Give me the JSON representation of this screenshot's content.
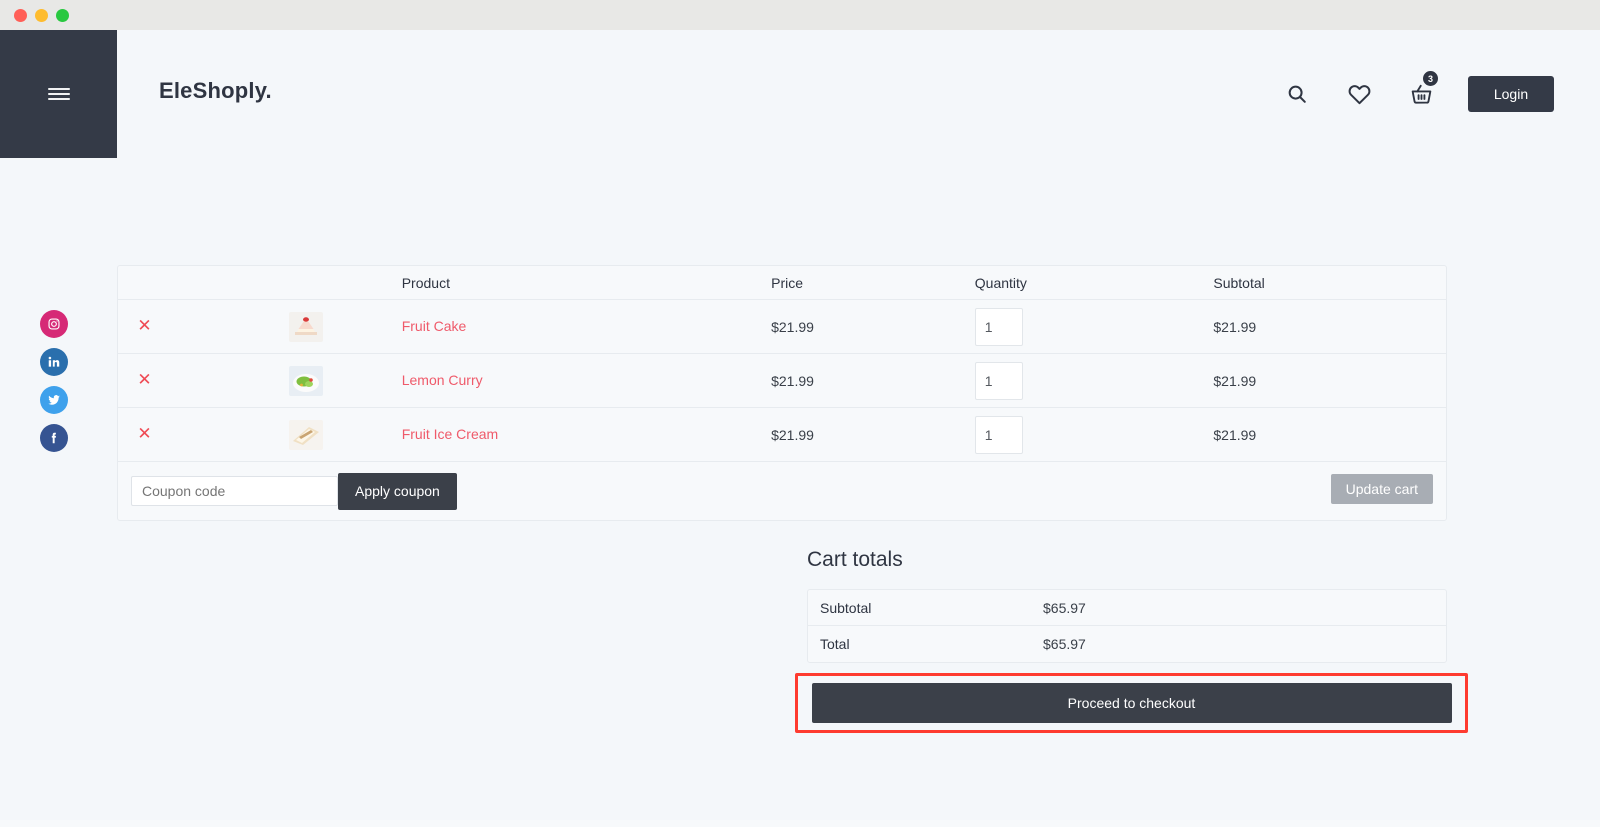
{
  "window": {
    "traffic_lights": [
      {
        "name": "close",
        "color": "#FF5F57"
      },
      {
        "name": "minimize",
        "color": "#FEBC2E"
      },
      {
        "name": "maximize",
        "color": "#28C840"
      }
    ]
  },
  "header": {
    "brand": "EleShoply.",
    "search_icon": "search-icon",
    "wishlist_icon": "heart-icon",
    "cart_icon": "shopping-basket-icon",
    "cart_count": "3",
    "login_label": "Login",
    "menu_icon": "hamburger-menu-icon"
  },
  "social": [
    {
      "name": "instagram",
      "glyph": "◎",
      "color": "#d62976"
    },
    {
      "name": "linkedin",
      "glyph": "in",
      "color": "#2a6fad"
    },
    {
      "name": "twitter",
      "glyph": "✉",
      "color": "#3ea1ec"
    },
    {
      "name": "facebook",
      "glyph": "f",
      "color": "#365492"
    }
  ],
  "cart": {
    "columns": [
      "",
      "",
      "Product",
      "Price",
      "Quantity",
      "Subtotal"
    ],
    "header": {
      "product": "Product",
      "price": "Price",
      "quantity": "Quantity",
      "subtotal": "Subtotal"
    },
    "remove_glyph": "✕",
    "items": [
      {
        "name": "Fruit Cake",
        "price": "$21.99",
        "quantity": "1",
        "subtotal": "$21.99",
        "thumb": "cake-slice-thumbnail"
      },
      {
        "name": "Lemon Curry",
        "price": "$21.99",
        "quantity": "1",
        "subtotal": "$21.99",
        "thumb": "salad-plate-thumbnail"
      },
      {
        "name": "Fruit Ice Cream",
        "price": "$21.99",
        "quantity": "1",
        "subtotal": "$21.99",
        "thumb": "ice-cream-thumbnail"
      }
    ],
    "coupon_placeholder": "Coupon code",
    "coupon_value": "",
    "apply_coupon_label": "Apply coupon",
    "update_cart_label": "Update cart"
  },
  "totals": {
    "title": "Cart totals",
    "rows": [
      {
        "label": "Subtotal",
        "value": "$65.97"
      },
      {
        "label": "Total",
        "value": "$65.97"
      }
    ],
    "checkout_label": "Proceed to checkout"
  },
  "colors": {
    "accent_red": "#ef5a6a",
    "dark": "#343a47",
    "page_bg": "#f4f7fa",
    "highlight_box": "#fe3b30"
  }
}
